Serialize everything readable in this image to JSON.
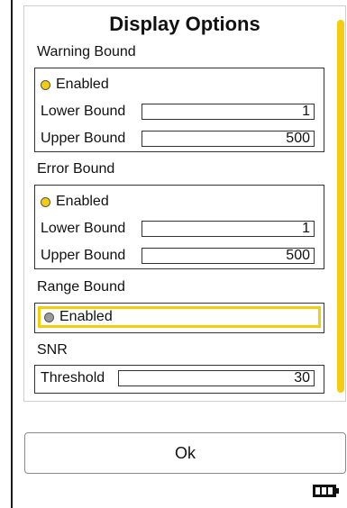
{
  "dialog": {
    "title": "Display Options"
  },
  "warning_bound": {
    "label": "Warning Bound",
    "enabled_label": "Enabled",
    "enabled": true,
    "lower_label": "Lower Bound",
    "lower_value": "1",
    "upper_label": "Upper Bound",
    "upper_value": "500"
  },
  "error_bound": {
    "label": "Error Bound",
    "enabled_label": "Enabled",
    "enabled": true,
    "lower_label": "Lower Bound",
    "lower_value": "1",
    "upper_label": "Upper Bound",
    "upper_value": "500"
  },
  "range_bound": {
    "label": "Range Bound",
    "enabled_label": "Enabled",
    "enabled": false
  },
  "snr": {
    "label": "SNR",
    "threshold_label": "Threshold",
    "threshold_value": "30"
  },
  "footer": {
    "ok_label": "Ok"
  },
  "colors": {
    "accent": "#f5cc10",
    "radio_off": "#9a9a9a"
  },
  "icons": {
    "battery": "battery-full-icon"
  }
}
